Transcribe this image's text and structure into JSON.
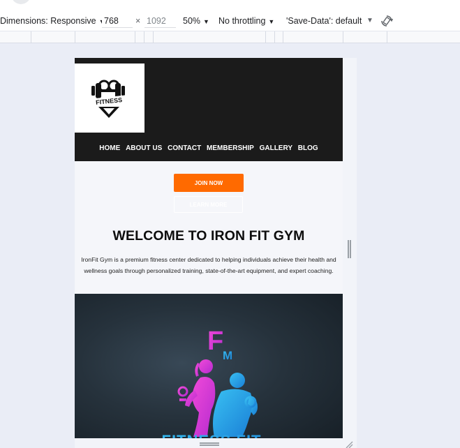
{
  "devtools": {
    "dimensions_label": "Dimensions: Responsive",
    "width_value": "768",
    "times_sign": "×",
    "height_placeholder": "1092",
    "zoom": "50%",
    "throttling": "No throttling",
    "save_data": "'Save-Data': default",
    "dropdown_arrow": "▼"
  },
  "site": {
    "logo_text": "FITNESS",
    "nav": [
      "HOME",
      "ABOUT US",
      "CONTACT",
      "MEMBERSHIP",
      "GALLERY",
      "BLOG"
    ],
    "join_button": "JOIN NOW",
    "secondary_button": "LEARN MORE",
    "heading": "WELCOME TO IRON FIT GYM",
    "description": "IronFit Gym is a premium fitness center dedicated to helping individuals achieve their health and wellness goals through personalized training, state-of-the-art equipment, and expert coaching.",
    "banner_logo": {
      "letter_f": "F",
      "letter_m": "M",
      "brand_text": "FITNESS FIT"
    }
  },
  "colors": {
    "accent_orange": "#ff6a00",
    "header_bg": "#1b1b1b",
    "magenta": "#e93dd0",
    "cyan": "#2aa6e8"
  }
}
